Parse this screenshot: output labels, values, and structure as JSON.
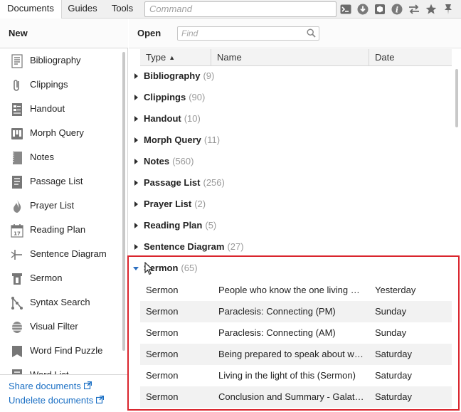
{
  "toolbar": {
    "tabs": [
      {
        "label": "Documents"
      },
      {
        "label": "Guides"
      },
      {
        "label": "Tools"
      }
    ],
    "command_placeholder": "Command",
    "icons": [
      "terminal-icon",
      "download-icon",
      "cube-icon",
      "info-icon",
      "sync-icon",
      "star-icon",
      "pin-icon"
    ]
  },
  "new_panel": {
    "title": "New",
    "items": [
      {
        "label": "Bibliography",
        "icon": "bibliography-icon"
      },
      {
        "label": "Clippings",
        "icon": "paperclip-icon"
      },
      {
        "label": "Handout",
        "icon": "handout-icon"
      },
      {
        "label": "Morph Query",
        "icon": "morph-query-icon"
      },
      {
        "label": "Notes",
        "icon": "notes-icon"
      },
      {
        "label": "Passage List",
        "icon": "passage-list-icon"
      },
      {
        "label": "Prayer List",
        "icon": "flame-icon"
      },
      {
        "label": "Reading Plan",
        "icon": "calendar-icon"
      },
      {
        "label": "Sentence Diagram",
        "icon": "sentence-diagram-icon"
      },
      {
        "label": "Sermon",
        "icon": "sermon-icon"
      },
      {
        "label": "Syntax Search",
        "icon": "syntax-search-icon"
      },
      {
        "label": "Visual Filter",
        "icon": "visual-filter-icon"
      },
      {
        "label": "Word Find Puzzle",
        "icon": "word-find-icon"
      },
      {
        "label": "Word List",
        "icon": "word-list-icon"
      }
    ],
    "links": [
      {
        "label": "Share documents"
      },
      {
        "label": "Undelete documents"
      }
    ]
  },
  "open_panel": {
    "title": "Open",
    "find_placeholder": "Find",
    "columns": {
      "type": "Type",
      "name": "Name",
      "date": "Date"
    },
    "groups": [
      {
        "name": "Bibliography",
        "count": "(9)",
        "expanded": false
      },
      {
        "name": "Clippings",
        "count": "(90)",
        "expanded": false
      },
      {
        "name": "Handout",
        "count": "(10)",
        "expanded": false
      },
      {
        "name": "Morph Query",
        "count": "(11)",
        "expanded": false
      },
      {
        "name": "Notes",
        "count": "(560)",
        "expanded": false
      },
      {
        "name": "Passage List",
        "count": "(256)",
        "expanded": false
      },
      {
        "name": "Prayer List",
        "count": "(2)",
        "expanded": false
      },
      {
        "name": "Reading Plan",
        "count": "(5)",
        "expanded": false
      },
      {
        "name": "Sentence Diagram",
        "count": "(27)",
        "expanded": false
      },
      {
        "name": "Sermon",
        "count": "(65)",
        "expanded": true
      }
    ],
    "sermon_rows": [
      {
        "type": "Sermon",
        "name": "People who know the one living God",
        "date": "Yesterday"
      },
      {
        "type": "Sermon",
        "name": "Paraclesis: Connecting (PM)",
        "date": "Sunday"
      },
      {
        "type": "Sermon",
        "name": "Paraclesis: Connecting (AM)",
        "date": "Sunday"
      },
      {
        "type": "Sermon",
        "name": "Being prepared to speak about what",
        "date": "Saturday"
      },
      {
        "type": "Sermon",
        "name": "Living in the light of this (Sermon)",
        "date": "Saturday"
      },
      {
        "type": "Sermon",
        "name": "Conclusion and Summary - Galatians",
        "date": "Saturday"
      }
    ]
  },
  "colors": {
    "accent": "#1a6fc4",
    "highlight_border": "#d9252d",
    "count_grey": "#999999",
    "icon_grey": "#6b6b6b"
  }
}
